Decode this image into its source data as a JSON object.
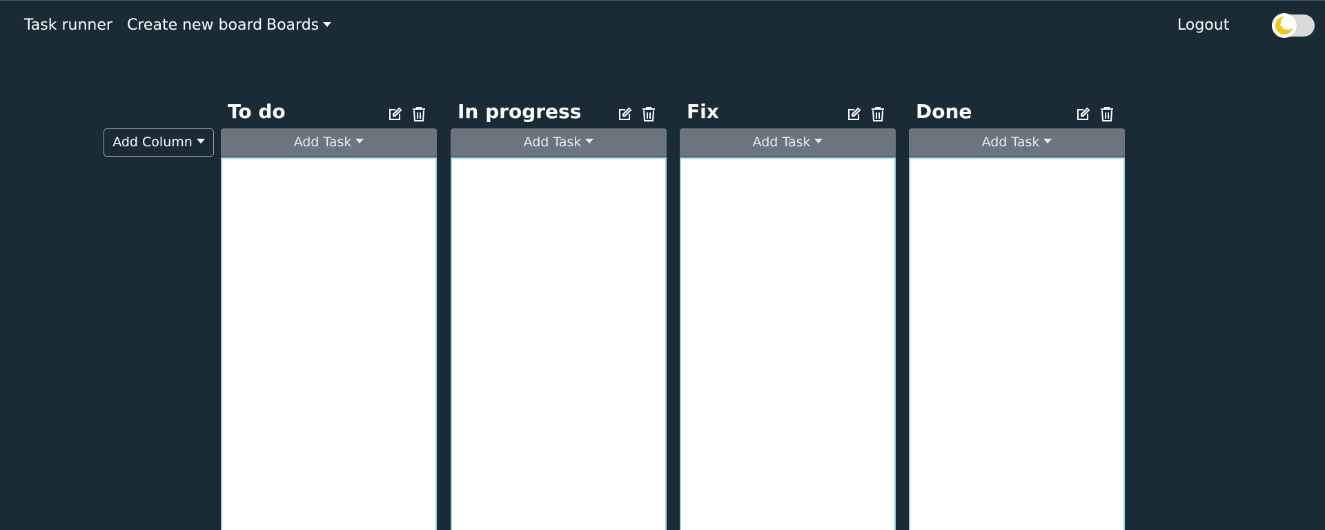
{
  "nav": {
    "brand": "Task runner",
    "create_board": "Create new board",
    "boards": "Boards",
    "logout": "Logout"
  },
  "theme_toggle": {
    "state": "dark",
    "icon": "moon-icon",
    "knob_color": "#f5c518"
  },
  "board": {
    "add_column_label": "Add Column",
    "columns": [
      {
        "title": "To do",
        "add_task_label": "Add Task",
        "tasks": []
      },
      {
        "title": "In progress",
        "add_task_label": "Add Task",
        "tasks": []
      },
      {
        "title": "Fix",
        "add_task_label": "Add Task",
        "tasks": []
      },
      {
        "title": "Done",
        "add_task_label": "Add Task",
        "tasks": []
      }
    ]
  },
  "colors": {
    "background": "#1b2b36",
    "add_task_bg": "#6c757d",
    "list_border": "#9bd4e4",
    "text": "#ffffff"
  }
}
